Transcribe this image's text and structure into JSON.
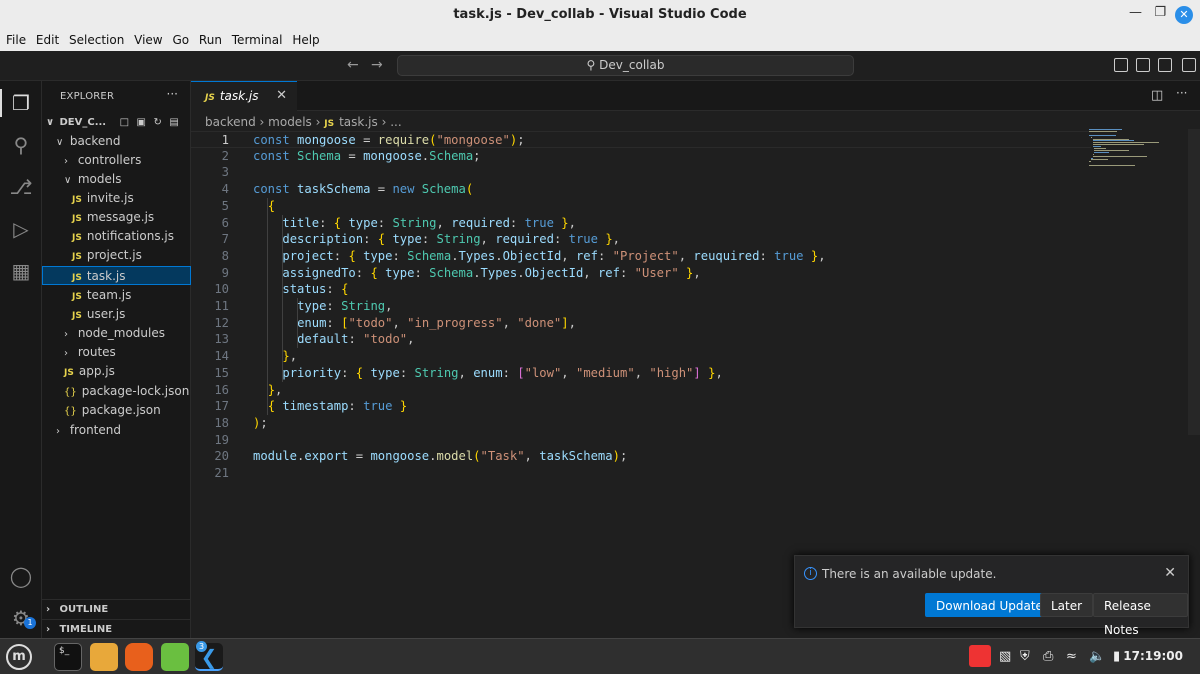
{
  "window": {
    "title": "task.js - Dev_collab - Visual Studio Code"
  },
  "menu": [
    "File",
    "Edit",
    "Selection",
    "View",
    "Go",
    "Run",
    "Terminal",
    "Help"
  ],
  "command_center": {
    "search_label": "Dev_collab"
  },
  "explorer": {
    "header": "EXPLORER",
    "root": "DEV_C...",
    "items": [
      {
        "label": "backend",
        "kind": "folder-open"
      },
      {
        "label": "controllers",
        "kind": "folder"
      },
      {
        "label": "models",
        "kind": "folder-open"
      },
      {
        "label": "invite.js",
        "kind": "js"
      },
      {
        "label": "message.js",
        "kind": "js"
      },
      {
        "label": "notifications.js",
        "kind": "js"
      },
      {
        "label": "project.js",
        "kind": "js"
      },
      {
        "label": "task.js",
        "kind": "js"
      },
      {
        "label": "team.js",
        "kind": "js"
      },
      {
        "label": "user.js",
        "kind": "js"
      },
      {
        "label": "node_modules",
        "kind": "folder"
      },
      {
        "label": "routes",
        "kind": "folder"
      },
      {
        "label": "app.js",
        "kind": "js"
      },
      {
        "label": "package-lock.json",
        "kind": "json"
      },
      {
        "label": "package.json",
        "kind": "json"
      },
      {
        "label": "frontend",
        "kind": "folder"
      }
    ],
    "outline": "OUTLINE",
    "timeline": "TIMELINE"
  },
  "accounts_badge": "1",
  "tab": {
    "icon_label": "JS",
    "label": "task.js"
  },
  "breadcrumbs": [
    "backend",
    "models",
    "task.js",
    "..."
  ],
  "code": {
    "current_line": 1,
    "lines": [
      "const mongoose = require(\"mongoose\");",
      "const Schema = mongoose.Schema;",
      "",
      "const taskSchema = new Schema(",
      "  {",
      "    title: { type: String, required: true },",
      "    description: { type: String, required: true },",
      "    project: { type: Schema.Types.ObjectId, ref: \"Project\", reuquired: true },",
      "    assignedTo: { type: Schema.Types.ObjectId, ref: \"User\" },",
      "    status: {",
      "      type: String,",
      "      enum: [\"todo\", \"in_progress\", \"done\"],",
      "      default: \"todo\",",
      "    },",
      "    priority: { type: String, enum: [\"low\", \"medium\", \"high\"] },",
      "  },",
      "  { timestamp: true }",
      ");",
      "",
      "module.export = mongoose.model(\"Task\", taskSchema);",
      ""
    ]
  },
  "notification": {
    "message": "There is an available update.",
    "buttons": [
      "Download Update",
      "Later",
      "Release Notes"
    ]
  },
  "taskbar": {
    "clock": "17:19:00",
    "vscode_badge": "3",
    "terminal_label": "$_"
  }
}
